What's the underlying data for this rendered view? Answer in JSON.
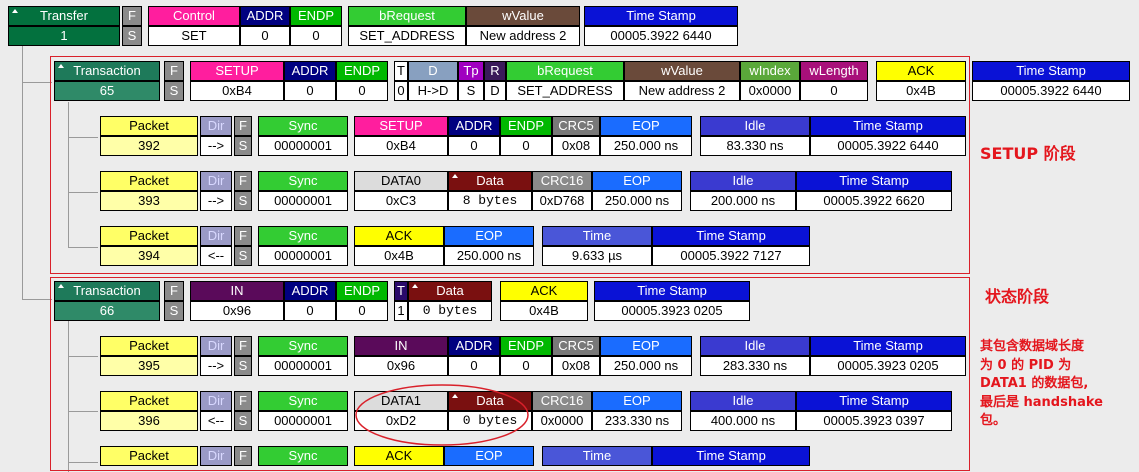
{
  "transfer": {
    "headers": [
      "Transfer",
      "F",
      "Control",
      "ADDR",
      "ENDP",
      "bRequest",
      "wValue",
      "Time Stamp"
    ],
    "values": [
      "1",
      "S",
      "SET",
      "0",
      "0",
      "SET_ADDRESS",
      "New address 2",
      "00005.3922 6440"
    ]
  },
  "trans65": {
    "headers": [
      "Transaction",
      "F",
      "SETUP",
      "ADDR",
      "ENDP",
      "T",
      "D",
      "Tp",
      "R",
      "bRequest",
      "wValue",
      "wIndex",
      "wLength",
      "ACK",
      "Time Stamp"
    ],
    "values": [
      "65",
      "S",
      "0xB4",
      "0",
      "0",
      "0",
      "H->D",
      "S",
      "D",
      "SET_ADDRESS",
      "New address 2",
      "0x0000",
      "0",
      "0x4B",
      "00005.3922 6440"
    ]
  },
  "pkt392": {
    "headers": [
      "Packet",
      "Dir",
      "F",
      "Sync",
      "SETUP",
      "ADDR",
      "ENDP",
      "CRC5",
      "EOP",
      "Idle",
      "Time Stamp"
    ],
    "values": [
      "392",
      "-->",
      "S",
      "00000001",
      "0xB4",
      "0",
      "0",
      "0x08",
      "250.000 ns",
      "83.330 ns",
      "00005.3922 6440"
    ]
  },
  "pkt393": {
    "headers": [
      "Packet",
      "Dir",
      "F",
      "Sync",
      "DATA0",
      "Data",
      "CRC16",
      "EOP",
      "Idle",
      "Time Stamp"
    ],
    "values": [
      "393",
      "-->",
      "S",
      "00000001",
      "0xC3",
      "8 bytes",
      "0xD768",
      "250.000 ns",
      "200.000 ns",
      "00005.3922 6620"
    ]
  },
  "pkt394": {
    "headers": [
      "Packet",
      "Dir",
      "F",
      "Sync",
      "ACK",
      "EOP",
      "Time",
      "Time Stamp"
    ],
    "values": [
      "394",
      "<--",
      "S",
      "00000001",
      "0x4B",
      "250.000 ns",
      "9.633 µs",
      "00005.3922 7127"
    ]
  },
  "trans66": {
    "headers": [
      "Transaction",
      "F",
      "IN",
      "ADDR",
      "ENDP",
      "T",
      "Data",
      "ACK",
      "Time Stamp"
    ],
    "values": [
      "66",
      "S",
      "0x96",
      "0",
      "0",
      "1",
      "0 bytes",
      "0x4B",
      "00005.3923 0205"
    ]
  },
  "pkt395": {
    "headers": [
      "Packet",
      "Dir",
      "F",
      "Sync",
      "IN",
      "ADDR",
      "ENDP",
      "CRC5",
      "EOP",
      "Idle",
      "Time Stamp"
    ],
    "values": [
      "395",
      "-->",
      "S",
      "00000001",
      "0x96",
      "0",
      "0",
      "0x08",
      "250.000 ns",
      "283.330 ns",
      "00005.3923 0205"
    ]
  },
  "pkt396": {
    "headers": [
      "Packet",
      "Dir",
      "F",
      "Sync",
      "DATA1",
      "Data",
      "CRC16",
      "EOP",
      "Idle",
      "Time Stamp"
    ],
    "values": [
      "396",
      "<--",
      "S",
      "00000001",
      "0xD2",
      "0 bytes",
      "0x0000",
      "233.330 ns",
      "400.000 ns",
      "00005.3923 0397"
    ]
  },
  "pkt397": {
    "headers": [
      "Packet",
      "Dir",
      "F",
      "Sync",
      "ACK",
      "EOP",
      "Time",
      "Time Stamp"
    ]
  },
  "annotations": {
    "setup_phase": "SETUP 阶段",
    "status_phase": "状态阶段",
    "note_lines": [
      "其包含数据域长度",
      "为 0 的 PID 为",
      "DATA1 的数据包,",
      "最后是 handshake",
      "包。"
    ]
  },
  "colors": {
    "annotation": "#e4161d"
  }
}
